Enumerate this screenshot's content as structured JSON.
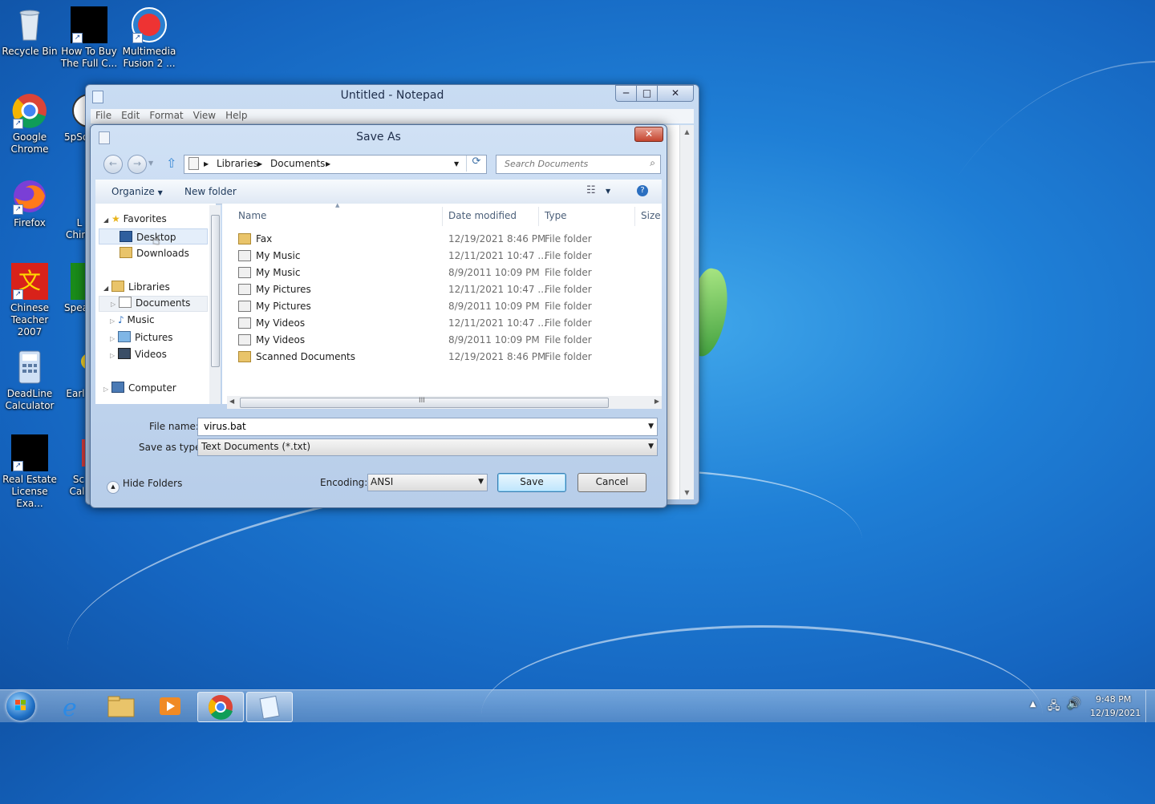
{
  "desktop": {
    "icons": [
      {
        "label1": "Recycle Bin",
        "label2": ""
      },
      {
        "label1": "How To Buy",
        "label2": "The Full C..."
      },
      {
        "label1": "Multimedia",
        "label2": "Fusion 2 ..."
      },
      {
        "label1": "Google",
        "label2": "Chrome"
      },
      {
        "label1": "5pSo",
        "label2": ""
      },
      {
        "label1": "Firefox",
        "label2": ""
      },
      {
        "label1": "L",
        "label2": "Chin"
      },
      {
        "label1": "Chinese",
        "label2": "Teacher 2007"
      },
      {
        "label1": "Spea",
        "label2": ""
      },
      {
        "label1": "DeadLine",
        "label2": "Calculator"
      },
      {
        "label1": "Earl",
        "label2": ""
      },
      {
        "label1": "Real Estate",
        "label2": "License Exa..."
      },
      {
        "label1": "Sc",
        "label2": "Cal"
      }
    ]
  },
  "notepad": {
    "title": "Untitled - Notepad",
    "menu": [
      "File",
      "Edit",
      "Format",
      "View",
      "Help"
    ],
    "minimize": "─",
    "maximize": "□",
    "close": "✕"
  },
  "dialog": {
    "title": "Save As",
    "close": "✕",
    "breadcrumb": [
      "Libraries",
      "Documents"
    ],
    "search_placeholder": "Search Documents",
    "toolbar": {
      "organize": "Organize",
      "new_folder": "New folder"
    },
    "nav": {
      "favorites": "Favorites",
      "desktop": "Desktop",
      "downloads": "Downloads",
      "libraries": "Libraries",
      "documents": "Documents",
      "music": "Music",
      "pictures": "Pictures",
      "videos": "Videos",
      "computer": "Computer"
    },
    "columns": {
      "name": "Name",
      "date": "Date modified",
      "type": "Type",
      "size": "Size"
    },
    "files": [
      {
        "name": "Fax",
        "date": "12/19/2021 8:46 PM",
        "type": "File folder",
        "kind": "folder"
      },
      {
        "name": "My Music",
        "date": "12/11/2021 10:47 ...",
        "type": "File folder",
        "kind": "shortcut"
      },
      {
        "name": "My Music",
        "date": "8/9/2011 10:09 PM",
        "type": "File folder",
        "kind": "shortcut"
      },
      {
        "name": "My Pictures",
        "date": "12/11/2021 10:47 ...",
        "type": "File folder",
        "kind": "shortcut"
      },
      {
        "name": "My Pictures",
        "date": "8/9/2011 10:09 PM",
        "type": "File folder",
        "kind": "shortcut"
      },
      {
        "name": "My Videos",
        "date": "12/11/2021 10:47 ...",
        "type": "File folder",
        "kind": "shortcut"
      },
      {
        "name": "My Videos",
        "date": "8/9/2011 10:09 PM",
        "type": "File folder",
        "kind": "shortcut"
      },
      {
        "name": "Scanned Documents",
        "date": "12/19/2021 8:46 PM",
        "type": "File folder",
        "kind": "folder"
      }
    ],
    "hscroll_grip": "III",
    "file_name_label": "File name:",
    "file_name_value": "virus.bat",
    "save_type_label": "Save as type:",
    "save_type_value": "Text Documents (*.txt)",
    "hide_folders": "Hide Folders",
    "encoding_label": "Encoding:",
    "encoding_value": "ANSI",
    "save_button": "Save",
    "cancel_button": "Cancel"
  },
  "taskbar": {
    "time": "9:48 PM",
    "date": "12/19/2021"
  },
  "colors": {
    "desktop_blue": "#1f7fd6",
    "dialog_frame": "#b7cde9",
    "close_red": "#c4452f"
  }
}
